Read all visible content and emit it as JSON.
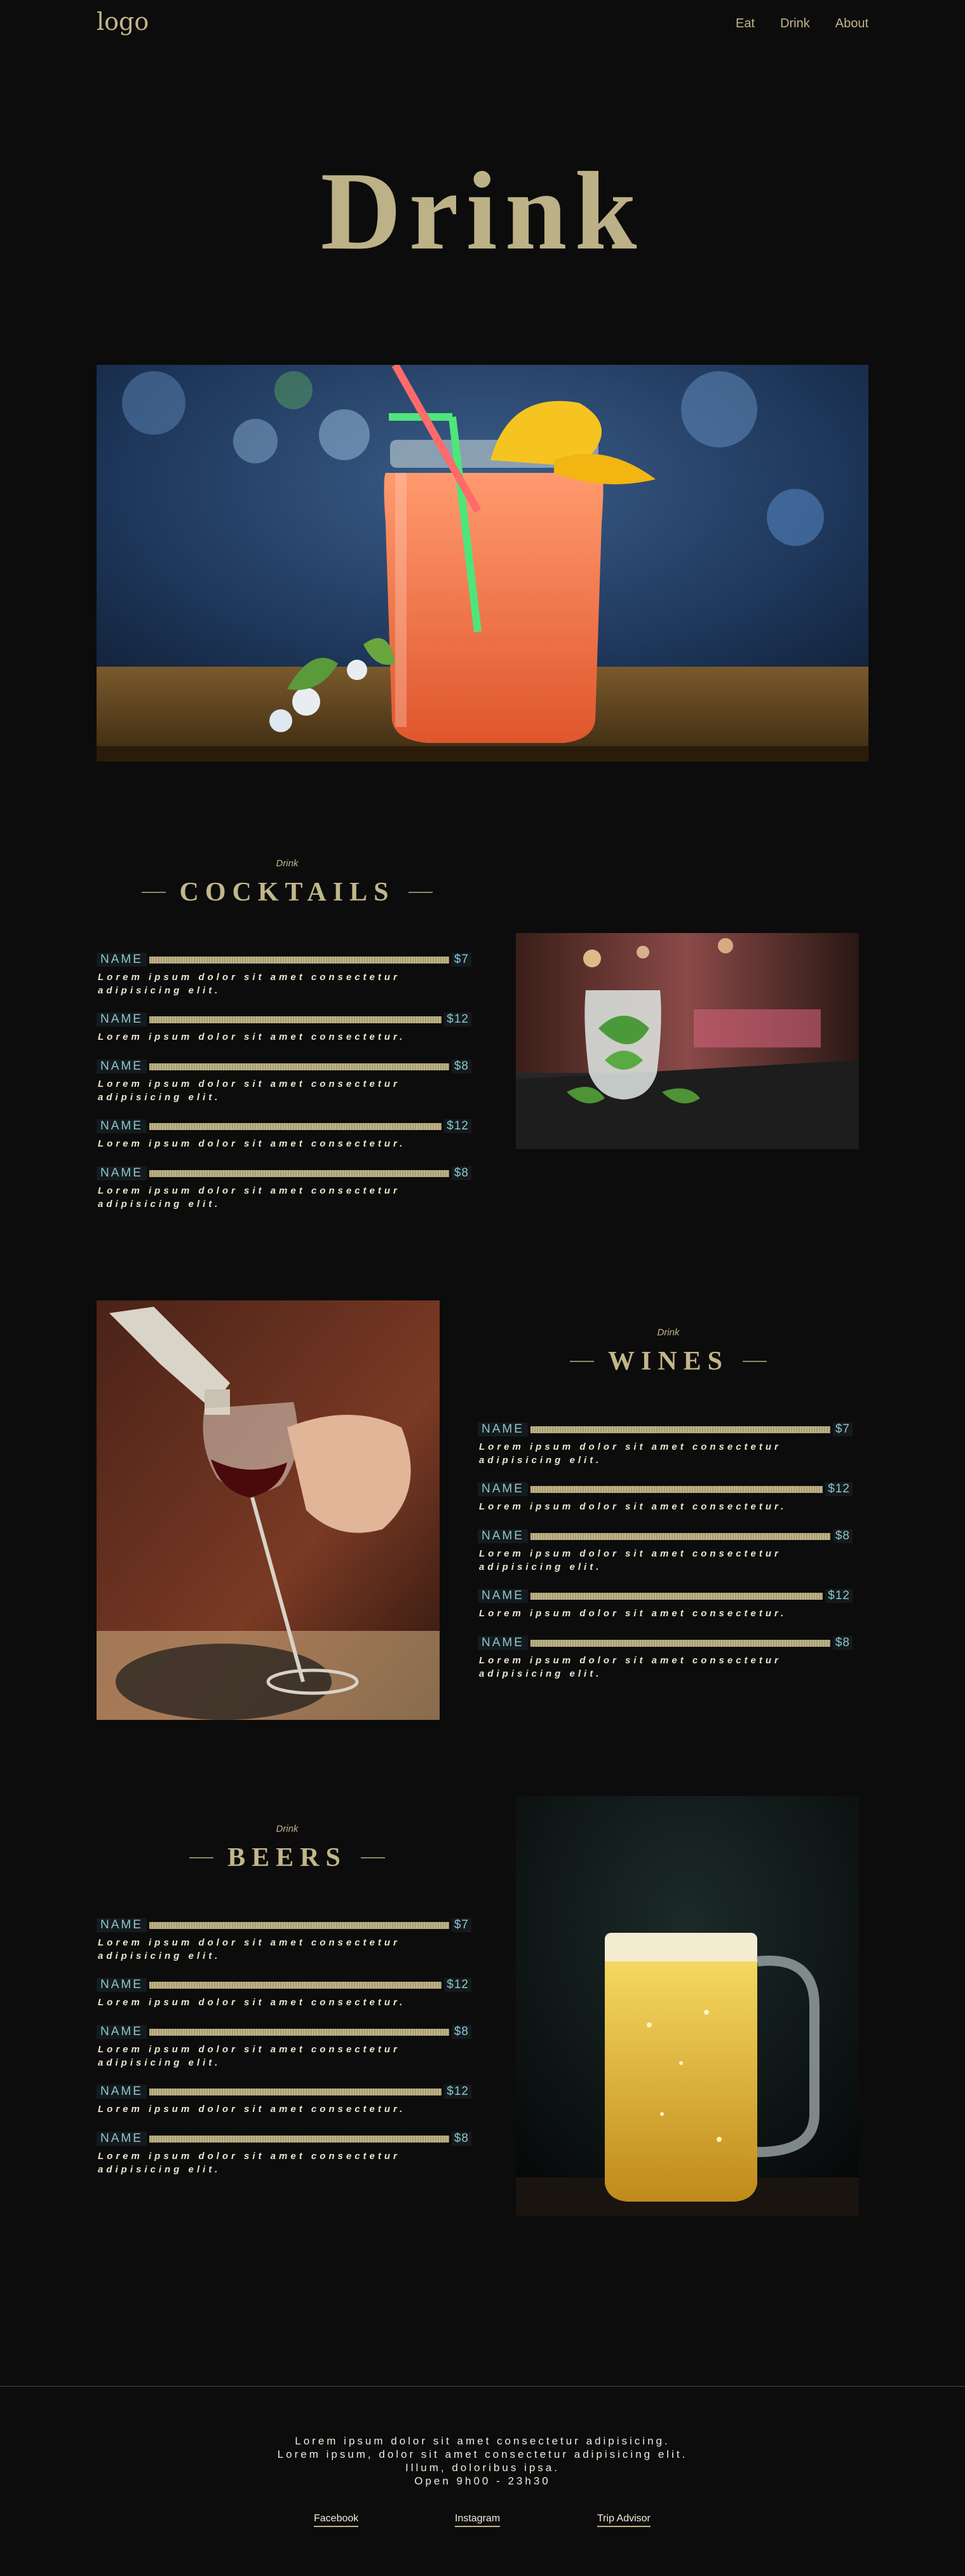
{
  "header": {
    "logo": "logo",
    "nav": [
      "Eat",
      "Drink",
      "About"
    ]
  },
  "hero": {
    "title": "Drink"
  },
  "cocktails": {
    "kicker": "Drink",
    "title": "COCKTAILS",
    "items": [
      {
        "name": "NAME",
        "price": "$7",
        "desc": "Lorem ipsum dolor sit amet consectetur adipisicing elit."
      },
      {
        "name": "NAME",
        "price": "$12",
        "desc": "Lorem ipsum dolor sit amet consectetur."
      },
      {
        "name": "NAME",
        "price": "$8",
        "desc": "Lorem ipsum dolor sit amet consectetur adipisicing elit."
      },
      {
        "name": "NAME",
        "price": "$12",
        "desc": "Lorem ipsum dolor sit amet consectetur."
      },
      {
        "name": "NAME",
        "price": "$8",
        "desc": "Lorem ipsum dolor sit amet consectetur adipisicing elit."
      }
    ]
  },
  "wines": {
    "kicker": "Drink",
    "title": "WINES",
    "items": [
      {
        "name": "NAME",
        "price": "$7",
        "desc": "Lorem ipsum dolor sit amet consectetur adipisicing elit."
      },
      {
        "name": "NAME",
        "price": "$12",
        "desc": "Lorem ipsum dolor sit amet consectetur."
      },
      {
        "name": "NAME",
        "price": "$8",
        "desc": "Lorem ipsum dolor sit amet consectetur adipisicing elit."
      },
      {
        "name": "NAME",
        "price": "$12",
        "desc": "Lorem ipsum dolor sit amet consectetur."
      },
      {
        "name": "NAME",
        "price": "$8",
        "desc": "Lorem ipsum dolor sit amet consectetur adipisicing elit."
      }
    ]
  },
  "beers": {
    "kicker": "Drink",
    "title": "BEERS",
    "items": [
      {
        "name": "NAME",
        "price": "$7",
        "desc": "Lorem ipsum dolor sit amet consectetur adipisicing elit."
      },
      {
        "name": "NAME",
        "price": "$12",
        "desc": "Lorem ipsum dolor sit amet consectetur."
      },
      {
        "name": "NAME",
        "price": "$8",
        "desc": "Lorem ipsum dolor sit amet consectetur adipisicing elit."
      },
      {
        "name": "NAME",
        "price": "$12",
        "desc": "Lorem ipsum dolor sit amet consectetur."
      },
      {
        "name": "NAME",
        "price": "$8",
        "desc": "Lorem ipsum dolor sit amet consectetur adipisicing elit."
      }
    ]
  },
  "footer": {
    "lines": [
      "Lorem ipsum dolor sit amet consectetur adipisicing.",
      "Lorem ipsum, dolor sit amet consectetur adipisicing elit.",
      "Illum, doloribus ipsa.",
      "Open 9h00 - 23h30"
    ],
    "links": [
      "Facebook",
      "Instagram",
      "Trip Advisor"
    ]
  },
  "colors": {
    "background": "#0c0c0c",
    "accent_gold": "#c2b68a",
    "item_name": "#8ec7cf"
  }
}
